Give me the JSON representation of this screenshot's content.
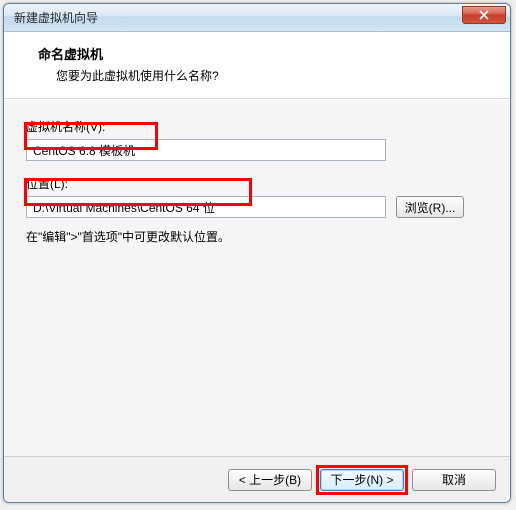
{
  "window": {
    "title": "新建虚拟机向导"
  },
  "header": {
    "title": "命名虚拟机",
    "subtitle": "您要为此虚拟机使用什么名称?"
  },
  "fields": {
    "name_label": "虚拟机名称(V):",
    "name_value": "CentOS 6.8 模板机",
    "location_label": "位置(L):",
    "location_value": "D:\\Virtual Machines\\CentOS 64 位",
    "browse_label": "浏览(R)..."
  },
  "hint": "在\"编辑\">\"首选项\"中可更改默认位置。",
  "footer": {
    "back": "< 上一步(B)",
    "next": "下一步(N) >",
    "cancel": "取消"
  }
}
